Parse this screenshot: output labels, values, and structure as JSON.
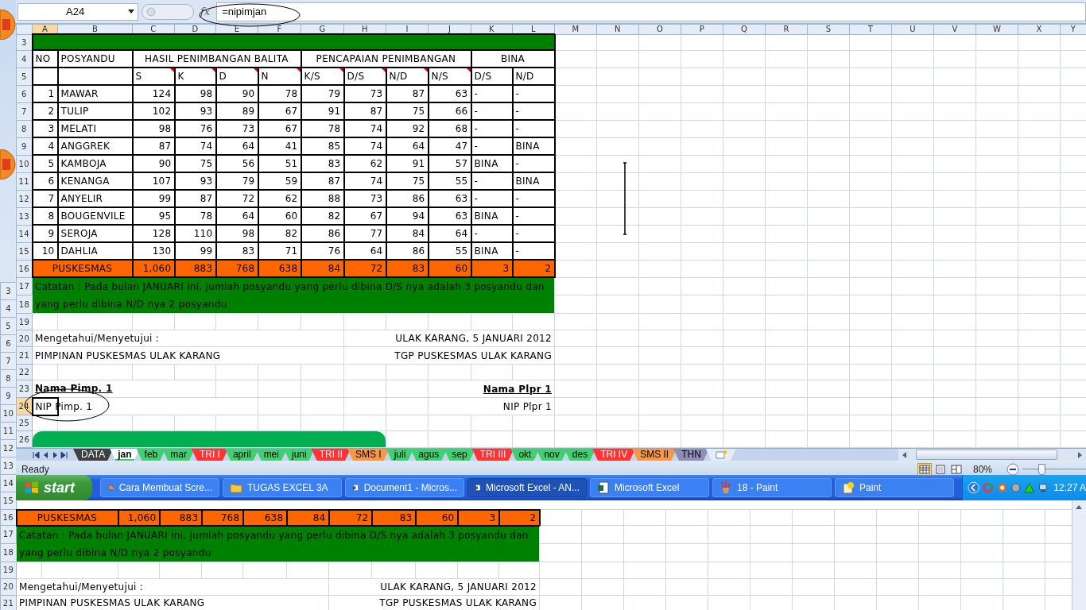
{
  "formula_bar": {
    "name_box": "A24",
    "function_label": "fx",
    "formula": "=nipimjan"
  },
  "sheet": {
    "columns": [
      {
        "label": "A",
        "selected": true
      },
      {
        "label": "B",
        "selected": false
      },
      {
        "label": "C",
        "selected": false
      },
      {
        "label": "D",
        "selected": false
      },
      {
        "label": "E",
        "selected": false
      },
      {
        "label": "F",
        "selected": false
      },
      {
        "label": "G",
        "selected": false
      },
      {
        "label": "H",
        "selected": false
      },
      {
        "label": "I",
        "selected": false
      },
      {
        "label": "J",
        "selected": false
      },
      {
        "label": "K",
        "selected": false
      },
      {
        "label": "L",
        "selected": false
      },
      {
        "label": "M",
        "selected": false
      },
      {
        "label": "N",
        "selected": false
      },
      {
        "label": "O",
        "selected": false
      },
      {
        "label": "P",
        "selected": false
      },
      {
        "label": "Q",
        "selected": false
      },
      {
        "label": "R",
        "selected": false
      },
      {
        "label": "S",
        "selected": false
      },
      {
        "label": "T",
        "selected": false
      },
      {
        "label": "U",
        "selected": false
      },
      {
        "label": "V",
        "selected": false
      },
      {
        "label": "W",
        "selected": false
      },
      {
        "label": "X",
        "selected": false
      },
      {
        "label": "Y",
        "selected": false
      }
    ],
    "row_numbers": [
      {
        "label": "3",
        "selected": false
      },
      {
        "label": "4",
        "selected": false
      },
      {
        "label": "5",
        "selected": false
      },
      {
        "label": "6",
        "selected": false
      },
      {
        "label": "7",
        "selected": false
      },
      {
        "label": "8",
        "selected": false
      },
      {
        "label": "9",
        "selected": false
      },
      {
        "label": "10",
        "selected": false
      },
      {
        "label": "11",
        "selected": false
      },
      {
        "label": "12",
        "selected": false
      },
      {
        "label": "13",
        "selected": false
      },
      {
        "label": "14",
        "selected": false
      },
      {
        "label": "15",
        "selected": false
      },
      {
        "label": "16",
        "selected": false
      },
      {
        "label": "17",
        "selected": false
      },
      {
        "label": "18",
        "selected": false
      },
      {
        "label": "19",
        "selected": false
      },
      {
        "label": "20",
        "selected": false
      },
      {
        "label": "21",
        "selected": false
      },
      {
        "label": "22",
        "selected": false
      },
      {
        "label": "23",
        "selected": false
      },
      {
        "label": "24",
        "selected": true
      },
      {
        "label": "25",
        "selected": false
      },
      {
        "label": "26",
        "selected": false
      }
    ],
    "group_headers": [
      "NO",
      "POSYANDU",
      "HASIL PENIMBANGAN BALITA",
      "PENCAPAIAN PENIMBANGAN",
      "BINA"
    ],
    "sub_headers": [
      {
        "label": "S",
        "comment": true
      },
      {
        "label": "K",
        "comment": true
      },
      {
        "label": "D",
        "comment": true
      },
      {
        "label": "N",
        "comment": true
      },
      {
        "label": "K/S",
        "comment": true
      },
      {
        "label": "D/S",
        "comment": true
      },
      {
        "label": "N/D",
        "comment": true
      },
      {
        "label": "N/S",
        "comment": true
      },
      {
        "label": "D/S",
        "comment": false
      },
      {
        "label": "N/D",
        "comment": false
      }
    ],
    "rows": [
      [
        "1",
        "MAWAR",
        "124",
        "98",
        "90",
        "78",
        "79",
        "73",
        "87",
        "63",
        "-",
        "-"
      ],
      [
        "2",
        "TULIP",
        "102",
        "93",
        "89",
        "67",
        "91",
        "87",
        "75",
        "66",
        "-",
        "-"
      ],
      [
        "3",
        "MELATI",
        "98",
        "76",
        "73",
        "67",
        "78",
        "74",
        "92",
        "68",
        "-",
        "-"
      ],
      [
        "4",
        "ANGGREK",
        "87",
        "74",
        "64",
        "41",
        "85",
        "74",
        "64",
        "47",
        "-",
        "BINA"
      ],
      [
        "5",
        "KAMBOJA",
        "90",
        "75",
        "56",
        "51",
        "83",
        "62",
        "91",
        "57",
        "BINA",
        "-"
      ],
      [
        "6",
        "KENANGA",
        "107",
        "93",
        "79",
        "59",
        "87",
        "74",
        "75",
        "55",
        "-",
        "BINA"
      ],
      [
        "7",
        "ANYELIR",
        "99",
        "87",
        "72",
        "62",
        "88",
        "73",
        "86",
        "63",
        "-",
        "-"
      ],
      [
        "8",
        "BOUGENVILE",
        "95",
        "78",
        "64",
        "60",
        "82",
        "67",
        "94",
        "63",
        "BINA",
        "-"
      ],
      [
        "9",
        "SEROJA",
        "128",
        "110",
        "98",
        "82",
        "86",
        "77",
        "84",
        "64",
        "-",
        "-"
      ],
      [
        "10",
        "DAHLIA",
        "130",
        "99",
        "83",
        "71",
        "76",
        "64",
        "86",
        "55",
        "BINA",
        "-"
      ]
    ],
    "total": {
      "label": "PUSKESMAS",
      "values": [
        "1,060",
        "883",
        "768",
        "638",
        "84",
        "72",
        "83",
        "60",
        "3",
        "2"
      ]
    },
    "note": "Catatan : Pada bulan JANUARI ini, jumlah posyandu yang perlu dibina D/S nya adalah 3 posyandu dan yang perlu dibina N/D nya 2  posyandu",
    "signatures": [
      {
        "title": "Mengetahui/Menyetujui :",
        "role": "PIMPINAN PUSKESMAS ULAK KARANG",
        "name": "Nama Pimp. 1",
        "nip": "NIP Pimp. 1"
      },
      {
        "title": "ULAK KARANG, 5 JANUARI 2012",
        "role": "TGP PUSKESMAS ULAK KARANG",
        "name": "Nama Plpr 1",
        "nip": "NIP Plpr 1"
      }
    ]
  },
  "sheet_tabs": [
    {
      "label": "DATA",
      "color": "#404040",
      "selected": false
    },
    {
      "label": "jan",
      "color": "#40d070",
      "selected": true
    },
    {
      "label": "feb",
      "color": "#40d070",
      "selected": false
    },
    {
      "label": "mar",
      "color": "#40d070",
      "selected": false
    },
    {
      "label": "TRI I",
      "color": "#ff3333",
      "selected": false
    },
    {
      "label": "april",
      "color": "#40d070",
      "selected": false
    },
    {
      "label": "mei",
      "color": "#40d070",
      "selected": false
    },
    {
      "label": "juni",
      "color": "#40d070",
      "selected": false
    },
    {
      "label": "TRI II",
      "color": "#ff3333",
      "selected": false
    },
    {
      "label": "SMS I",
      "color": "#f79646",
      "selected": false
    },
    {
      "label": "juli",
      "color": "#40d070",
      "selected": false
    },
    {
      "label": "agus",
      "color": "#40d070",
      "selected": false
    },
    {
      "label": "sep",
      "color": "#40d070",
      "selected": false
    },
    {
      "label": "TRI III",
      "color": "#ff3333",
      "selected": false
    },
    {
      "label": "okt",
      "color": "#40d070",
      "selected": false
    },
    {
      "label": "nov",
      "color": "#40d070",
      "selected": false
    },
    {
      "label": "des",
      "color": "#40d070",
      "selected": false
    },
    {
      "label": "TRI IV",
      "color": "#ff3333",
      "selected": false
    },
    {
      "label": "SMS II",
      "color": "#f79646",
      "selected": false
    },
    {
      "label": "THN",
      "color": "#8e8eb4",
      "selected": false
    }
  ],
  "status_bar": {
    "mode": "Ready",
    "views": [
      {
        "kind": "normal",
        "selected": true
      },
      {
        "kind": "layout",
        "selected": false
      },
      {
        "kind": "pagebreak",
        "selected": false
      }
    ],
    "zoom": "80%",
    "zoom_slider": {
      "level": 0.3
    }
  },
  "taskbar": {
    "start": "start",
    "tasks": [
      {
        "label": "Cara Membuat Scre...",
        "kind": "browser",
        "selected": false
      },
      {
        "label": "TUGAS EXCEL 3A",
        "kind": "folder",
        "selected": false
      },
      {
        "label": "Document1 - Micros...",
        "kind": "document",
        "selected": false
      },
      {
        "label": "Microsoft Excel - AN...",
        "kind": "spreadsheet",
        "selected": true
      },
      {
        "label": "Microsoft Excel",
        "kind": "spreadsheet",
        "selected": false
      },
      {
        "label": "18 - Paint",
        "kind": "paint",
        "selected": false
      },
      {
        "label": "Paint",
        "kind": "help",
        "selected": false
      }
    ],
    "clock": "12:27 A"
  },
  "back_window": {
    "row_numbers": [
      "3",
      "4",
      "5",
      "6",
      "7",
      "8",
      "9",
      "10",
      "11",
      "12",
      "13",
      "14",
      "15",
      "16",
      "17",
      "18",
      "19",
      "20",
      "21"
    ],
    "total": {
      "label": "PUSKESMAS",
      "values": [
        "1,060",
        "883",
        "768",
        "638",
        "84",
        "72",
        "83",
        "60",
        "3",
        "2"
      ]
    },
    "note": "Catatan : Pada bulan JANUARI ini, jumlah posyandu yang perlu dibina D/S nya adalah 3 posyandu dan yang perlu dibina N/D nya 2  posyandu",
    "signatures": [
      {
        "title": "Mengetahui/Menyetujui :",
        "role": "PIMPINAN PUSKESMAS ULAK KARANG"
      },
      {
        "title": "ULAK KARANG, 5 JANUARI 2012",
        "role": "TGP PUSKESMAS ULAK KARANG"
      }
    ]
  }
}
